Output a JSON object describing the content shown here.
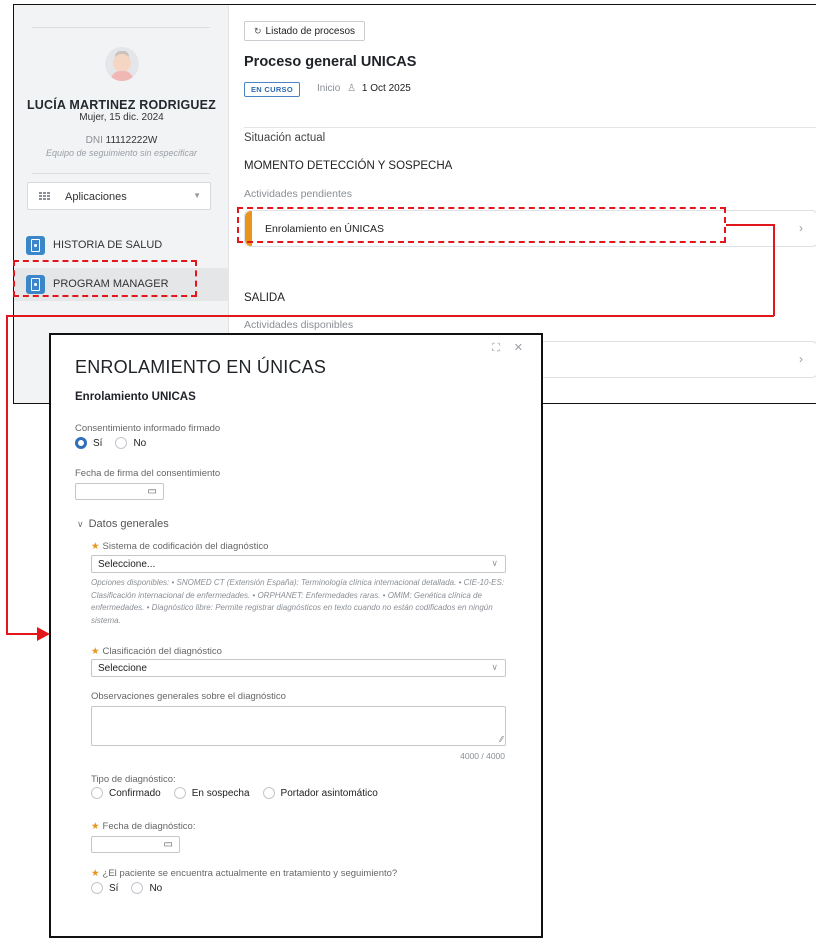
{
  "patient": {
    "name": "LUCÍA MARTINEZ RODRIGUEZ",
    "sex_birth": "Mujer, 15 dic. 2024",
    "dni_label": "DNI",
    "dni": "11112222W",
    "team": "Equipo de seguimiento sin especificar"
  },
  "sidebar": {
    "apps_label": "Aplicaciones",
    "items": [
      {
        "label": "HISTORIA DE SALUD"
      },
      {
        "label": "PROGRAM MANAGER"
      }
    ]
  },
  "main": {
    "process_list_button": "Listado de procesos",
    "process_title": "Proceso general UNICAS",
    "status_badge": "EN CURSO",
    "start_label": "Inicio",
    "start_date": "1 Oct 2025",
    "current_situation": "Situación actual",
    "moment": "MOMENTO DETECCIÓN Y SOSPECHA",
    "pending_label": "Actividades pendientes",
    "pending_activity": "Enrolamiento en ÚNICAS",
    "exit_label": "SALIDA",
    "available_label": "Actividades disponibles"
  },
  "modal": {
    "title": "ENROLAMIENTO EN ÚNICAS",
    "subtitle": "Enrolamiento UNICAS",
    "consent_label": "Consentimiento informado firmado",
    "consent_options": [
      "Sí",
      "No"
    ],
    "consent_selected": "Sí",
    "consent_date_label": "Fecha de firma del consentimiento",
    "section_general": "Datos generales",
    "coding_system_label": "Sistema de codificación del diagnóstico",
    "coding_system_value": "Seleccione...",
    "coding_help": "Opciones disponibles: • SNOMED CT (Extensión España): Terminología clínica internacional detallada. • CIE-10-ES: Clasificación internacional de enfermedades. • ORPHANET: Enfermedades raras. • OMIM: Genética clínica de enfermedades. • Diagnóstico libre: Permite registrar diagnósticos en texto cuando no están codificados en ningún sistema.",
    "classification_label": "Clasificación del diagnóstico",
    "classification_value": "Seleccione",
    "observations_label": "Observaciones generales sobre el diagnóstico",
    "observations_counter": "4000 / 4000",
    "diagnosis_type_label": "Tipo de diagnóstico:",
    "diagnosis_type_options": [
      "Confirmado",
      "En sospecha",
      "Portador asintomático"
    ],
    "diagnosis_date_label": "Fecha de diagnóstico:",
    "treatment_label": "¿El paciente se encuentra actualmente en tratamiento y seguimiento?",
    "treatment_options": [
      "Sí",
      "No"
    ]
  },
  "colors": {
    "highlight": "#e3161b",
    "accent": "#2f6fb8",
    "activity_bar": "#e9941a"
  }
}
